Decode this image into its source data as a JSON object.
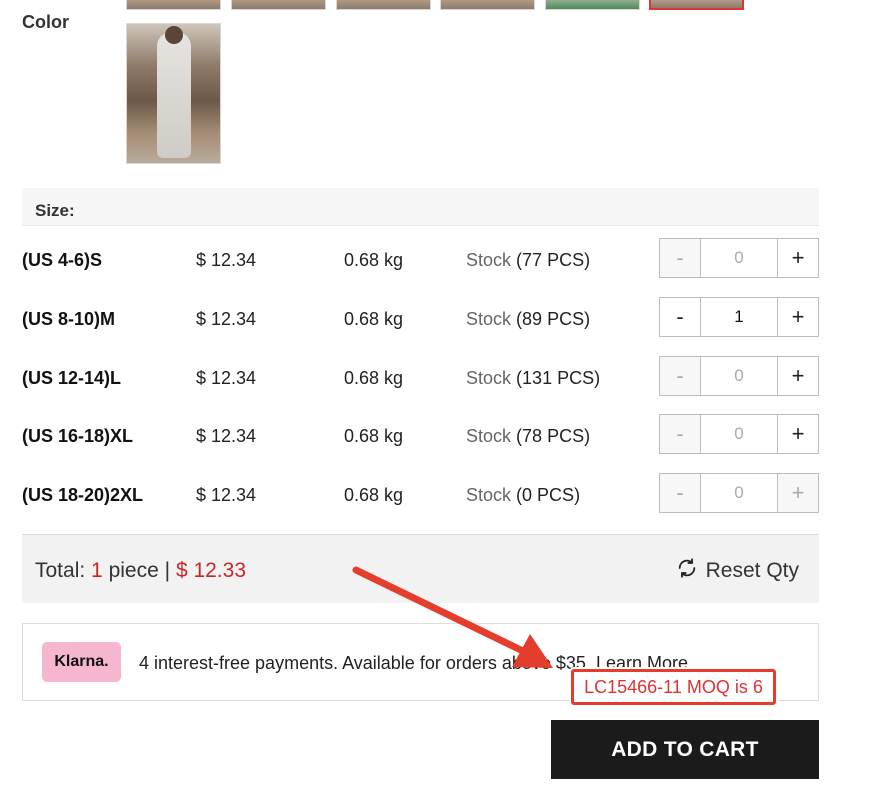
{
  "color_section": {
    "label": "Color"
  },
  "size_section": {
    "header": "Size:",
    "rows": [
      {
        "size": "(US 4-6)S",
        "price": "$ 12.34",
        "weight": "0.68 kg",
        "stock_label": "Stock",
        "stock_qty": "(77 PCS)",
        "qty": "0",
        "minus": "-",
        "plus": "+"
      },
      {
        "size": "(US 8-10)M",
        "price": "$ 12.34",
        "weight": "0.68 kg",
        "stock_label": "Stock",
        "stock_qty": "(89 PCS)",
        "qty": "1",
        "minus": "-",
        "plus": "+"
      },
      {
        "size": "(US 12-14)L",
        "price": "$ 12.34",
        "weight": "0.68 kg",
        "stock_label": "Stock",
        "stock_qty": "(131 PCS)",
        "qty": "0",
        "minus": "-",
        "plus": "+"
      },
      {
        "size": "(US 16-18)XL",
        "price": "$ 12.34",
        "weight": "0.68 kg",
        "stock_label": "Stock",
        "stock_qty": "(78 PCS)",
        "qty": "0",
        "minus": "-",
        "plus": "+"
      },
      {
        "size": "(US 18-20)2XL",
        "price": "$ 12.34",
        "weight": "0.68 kg",
        "stock_label": "Stock",
        "stock_qty": "(0 PCS)",
        "qty": "0",
        "minus": "-",
        "plus": "+"
      }
    ]
  },
  "total": {
    "prefix": "Total:",
    "count": "1",
    "unit": "piece",
    "separator": "|",
    "amount": "$ 12.33",
    "reset_label": "Reset Qty"
  },
  "klarna": {
    "badge": "Klarna.",
    "text": "4 interest-free payments. Available for orders above $35.",
    "learn_more": "Learn More"
  },
  "moq_message": "LC15466-11 MOQ is 6",
  "add_to_cart": "ADD TO CART",
  "colors": {
    "accent_red": "#c62828",
    "annotation_red": "#e53d2d",
    "button_dark": "#1b1b1b",
    "klarna_pink": "#f7b6cf"
  }
}
